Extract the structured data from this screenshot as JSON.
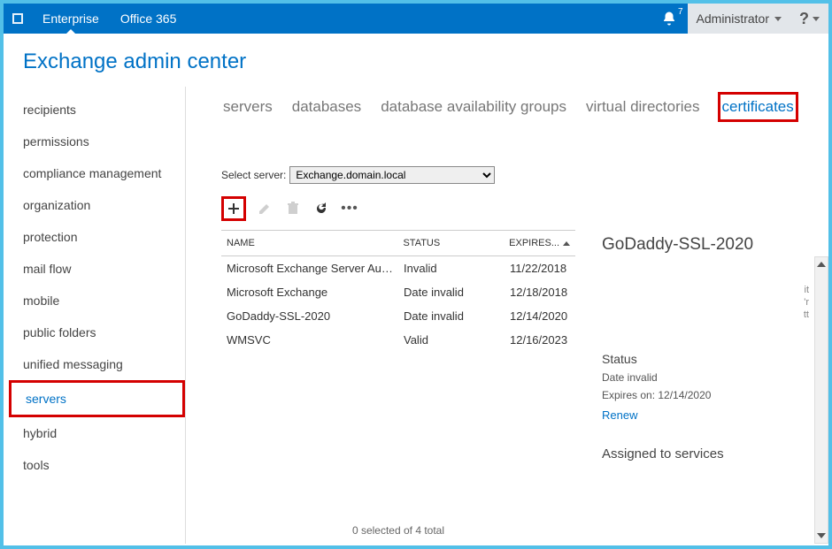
{
  "topbar": {
    "links": [
      "Enterprise",
      "Office 365"
    ],
    "notif_count": "7",
    "admin_label": "Administrator"
  },
  "page_title": "Exchange admin center",
  "sidebar": {
    "items": [
      "recipients",
      "permissions",
      "compliance management",
      "organization",
      "protection",
      "mail flow",
      "mobile",
      "public folders",
      "unified messaging",
      "servers",
      "hybrid",
      "tools"
    ],
    "selected_index": 9
  },
  "tabs": {
    "items": [
      "servers",
      "databases",
      "database availability groups",
      "virtual directories",
      "certificates"
    ],
    "selected_index": 4
  },
  "server_label": "Select server:",
  "server_value": "Exchange.domain.local",
  "table": {
    "headers": {
      "name": "NAME",
      "status": "STATUS",
      "expires": "EXPIRES..."
    },
    "rows": [
      {
        "name": "Microsoft Exchange Server Auth ...",
        "status": "Invalid",
        "expires": "11/22/2018"
      },
      {
        "name": "Microsoft Exchange",
        "status": "Date invalid",
        "expires": "12/18/2018"
      },
      {
        "name": "GoDaddy-SSL-2020",
        "status": "Date invalid",
        "expires": "12/14/2020"
      },
      {
        "name": "WMSVC",
        "status": "Valid",
        "expires": "12/16/2023"
      }
    ],
    "footer": "0 selected of 4 total"
  },
  "details": {
    "title": "GoDaddy-SSL-2020",
    "status_heading": "Status",
    "status_value": "Date invalid",
    "expires_label": "Expires on: 12/14/2020",
    "renew_label": "Renew",
    "assigned_heading": "Assigned to services",
    "stray1": "it",
    "stray2": "'r",
    "stray3": "tt"
  }
}
